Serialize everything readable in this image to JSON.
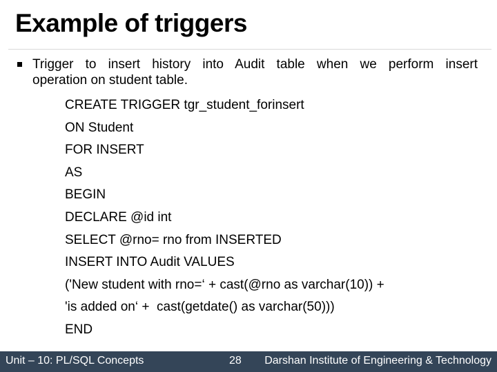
{
  "slide": {
    "title": "Example of triggers",
    "bullet": {
      "icon": "square-bullet-icon",
      "line1": "Trigger to insert history into Audit table when we perform insert",
      "line2": "operation on student table."
    },
    "code_lines": [
      "CREATE TRIGGER tgr_student_forinsert",
      "ON Student",
      "FOR INSERT",
      "AS",
      "BEGIN",
      "DECLARE @id int",
      "SELECT @rno= rno from INSERTED",
      "INSERT INTO Audit VALUES",
      "('New student with rno=‘ + cast(@rno as varchar(10)) +",
      "'is added on‘ +  cast(getdate() as varchar(50)))",
      "END"
    ]
  },
  "footer": {
    "unit": "Unit – 10: PL/SQL Concepts",
    "page_number": "28",
    "institute": "Darshan Institute of Engineering & Technology",
    "background_color": "#344558"
  }
}
